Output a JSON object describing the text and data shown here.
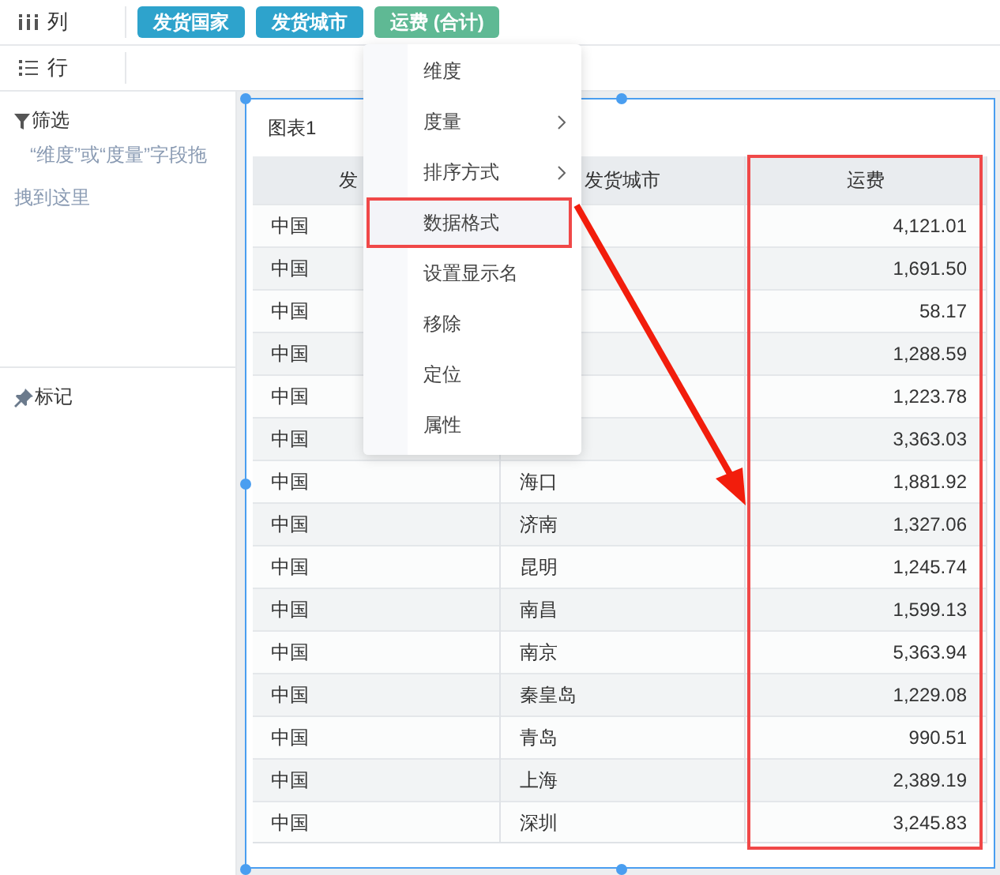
{
  "shelves": [
    {
      "kind": "columns",
      "label": "列",
      "fields": [
        {
          "label": "发货国家",
          "color": "#2ea3cc"
        },
        {
          "label": "发货城市",
          "color": "#2ea3cc"
        },
        {
          "label": "运费 (合计)",
          "color": "#5fb994"
        }
      ]
    },
    {
      "kind": "rows",
      "label": "行"
    }
  ],
  "filter": {
    "label": "筛选",
    "hint": "“维度”或“度量”字段拖拽到这里"
  },
  "marks": {
    "label": "标记"
  },
  "chart": {
    "title": "图表1",
    "columns": [
      "发",
      "发货城市",
      "运费"
    ],
    "rows": [
      [
        "中国",
        null,
        "4,121.01"
      ],
      [
        "中国",
        null,
        "1,691.50"
      ],
      [
        "中国",
        null,
        "58.17"
      ],
      [
        "中国",
        null,
        "1,288.59"
      ],
      [
        "中国",
        null,
        "1,223.78"
      ],
      [
        "中国",
        null,
        "3,363.03"
      ],
      [
        "中国",
        "海口",
        "1,881.92"
      ],
      [
        "中国",
        "济南",
        "1,327.06"
      ],
      [
        "中国",
        "昆明",
        "1,245.74"
      ],
      [
        "中国",
        "南昌",
        "1,599.13"
      ],
      [
        "中国",
        "南京",
        "5,363.94"
      ],
      [
        "中国",
        "秦皇岛",
        "1,229.08"
      ],
      [
        "中国",
        "青岛",
        "990.51"
      ],
      [
        "中国",
        "上海",
        "2,389.19"
      ],
      [
        "中国",
        "深圳",
        "3,245.83"
      ]
    ]
  },
  "menu": [
    {
      "label": "维度",
      "submenu": false,
      "selected": false
    },
    {
      "label": "度量",
      "submenu": true,
      "selected": false
    },
    {
      "label": "排序方式",
      "submenu": true,
      "selected": false
    },
    {
      "label": "数据格式",
      "submenu": false,
      "selected": true
    },
    {
      "label": "设置显示名",
      "submenu": false,
      "selected": false
    },
    {
      "label": "移除",
      "submenu": false,
      "selected": false
    },
    {
      "label": "定位",
      "submenu": false,
      "selected": false
    },
    {
      "label": "属性",
      "submenu": false,
      "selected": false
    }
  ]
}
